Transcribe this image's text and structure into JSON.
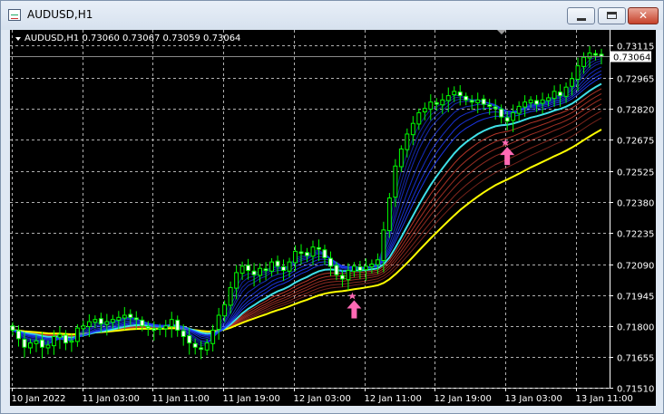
{
  "window": {
    "title": "AUDUSD,H1",
    "close_glyph": "✕",
    "icons": {
      "app": "chart-window-icon",
      "minimize": "minimize-icon",
      "maximize": "maximize-icon",
      "close": "close-icon"
    }
  },
  "chart": {
    "header": "AUDUSD,H1  0.73060 0.73067 0.73059 0.73064",
    "current_price": "0.73064",
    "colors": {
      "background": "#000000",
      "grid": "#b0b0b0",
      "bull": "#00ff00",
      "bear": "#ffffff",
      "fast_ribbon": "#1e3cff",
      "slow_ribbon": "#c0392b",
      "cyan_line": "#3fe0e8",
      "yellow_line": "#ffff00",
      "arrow": "#ff69b4",
      "axis_text": "#ffffff",
      "price_box": "#ffffff"
    }
  },
  "chart_data": {
    "type": "candlestick",
    "symbol": "AUDUSD",
    "timeframe": "H1",
    "ohlc_last": {
      "open": 0.7306,
      "high": 0.73067,
      "low": 0.73059,
      "close": 0.73064
    },
    "price_ticks": [
      "0.73115",
      "0.72965",
      "0.72820",
      "0.72675",
      "0.72525",
      "0.72380",
      "0.72235",
      "0.72090",
      "0.71945",
      "0.71800",
      "0.71655",
      "0.71510"
    ],
    "time_ticks": [
      "10 Jan 2022",
      "11 Jan 03:00",
      "11 Jan 11:00",
      "11 Jan 19:00",
      "12 Jan 03:00",
      "12 Jan 11:00",
      "12 Jan 19:00",
      "13 Jan 03:00",
      "13 Jan 11:00"
    ],
    "ylim": [
      0.7151,
      0.7318
    ],
    "grid": true,
    "close_series": [
      0.7178,
      0.7174,
      0.717,
      0.7172,
      0.7173,
      0.717,
      0.7171,
      0.7175,
      0.7176,
      0.7172,
      0.7173,
      0.7179,
      0.718,
      0.7182,
      0.7183,
      0.7181,
      0.7182,
      0.7183,
      0.7184,
      0.7185,
      0.7184,
      0.7183,
      0.718,
      0.7179,
      0.7178,
      0.7179,
      0.718,
      0.7183,
      0.7178,
      0.7175,
      0.7172,
      0.717,
      0.7169,
      0.7172,
      0.7178,
      0.7185,
      0.719,
      0.7198,
      0.7205,
      0.7208,
      0.7206,
      0.7204,
      0.7207,
      0.7206,
      0.721,
      0.7208,
      0.7206,
      0.721,
      0.7215,
      0.7214,
      0.7213,
      0.7217,
      0.7216,
      0.7212,
      0.7208,
      0.7204,
      0.7202,
      0.7206,
      0.7208,
      0.7206,
      0.7208,
      0.7209,
      0.7211,
      0.7225,
      0.724,
      0.7255,
      0.7263,
      0.727,
      0.7275,
      0.728,
      0.7282,
      0.7285,
      0.7284,
      0.7286,
      0.7288,
      0.729,
      0.7288,
      0.7286,
      0.7285,
      0.7286,
      0.7284,
      0.7283,
      0.7282,
      0.7278,
      0.7276,
      0.728,
      0.7283,
      0.7285,
      0.7286,
      0.7284,
      0.7286,
      0.7287,
      0.729,
      0.7288,
      0.7292,
      0.7296,
      0.7302,
      0.7306,
      0.7308,
      0.7307,
      0.73064
    ],
    "signals": [
      {
        "type": "buy-arrow",
        "index": 58,
        "price": 0.7192
      },
      {
        "type": "buy-arrow",
        "index": 84,
        "price": 0.7264
      }
    ]
  }
}
